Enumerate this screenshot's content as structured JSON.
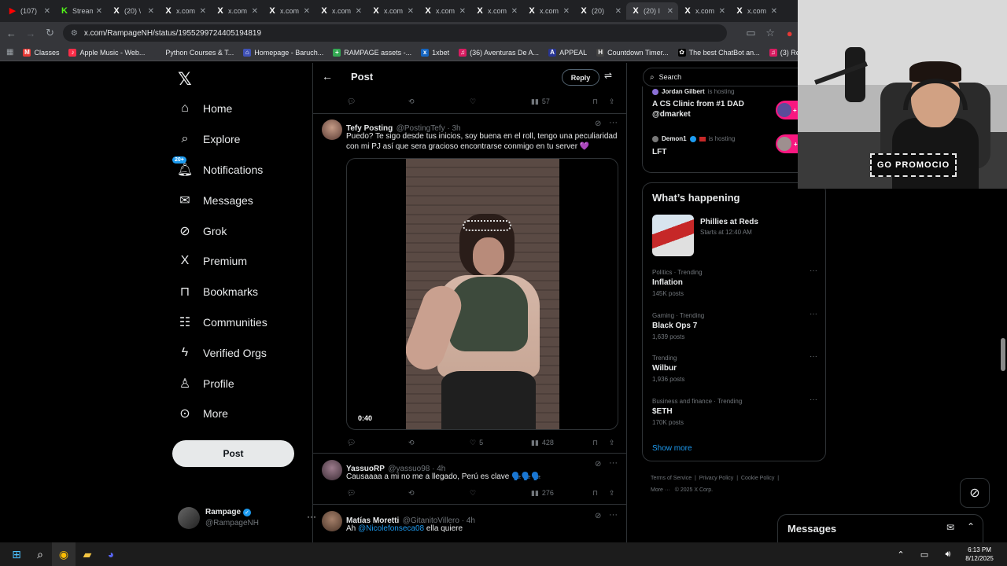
{
  "browser": {
    "tabs": [
      {
        "label": "(107)",
        "icon": "youtube-icon",
        "color": "#ff0000"
      },
      {
        "label": "Stream",
        "icon": "kick-icon",
        "color": "#53fc18"
      },
      {
        "label": "(20) \\",
        "icon": "x-logo-icon",
        "color": "#ffffff"
      },
      {
        "label": "x.com",
        "icon": "x-logo-icon",
        "color": "#ffffff"
      },
      {
        "label": "x.com",
        "icon": "x-logo-icon",
        "color": "#ffffff"
      },
      {
        "label": "x.com",
        "icon": "x-logo-icon",
        "color": "#ffffff"
      },
      {
        "label": "x.com",
        "icon": "x-logo-icon",
        "color": "#ffffff"
      },
      {
        "label": "x.com",
        "icon": "x-logo-icon",
        "color": "#ffffff"
      },
      {
        "label": "x.com",
        "icon": "x-logo-icon",
        "color": "#ffffff"
      },
      {
        "label": "x.com",
        "icon": "x-logo-icon",
        "color": "#ffffff"
      },
      {
        "label": "x.com",
        "icon": "x-logo-icon",
        "color": "#ffffff"
      },
      {
        "label": "(20)",
        "icon": "x-logo-icon",
        "color": "#ffffff"
      },
      {
        "label": "(20) I",
        "icon": "x-logo-icon",
        "color": "#ffffff",
        "active": true
      },
      {
        "label": "x.com",
        "icon": "x-logo-icon",
        "color": "#ffffff"
      },
      {
        "label": "x.com",
        "icon": "x-logo-icon",
        "color": "#ffffff"
      }
    ],
    "url": "x.com/RampageNH/status/1955299724405194819",
    "bookmarks": [
      {
        "label": "Classes",
        "color": "#e53935",
        "glyph": "M"
      },
      {
        "label": "Apple Music - Web...",
        "color": "#fa2d48",
        "glyph": "♪"
      },
      {
        "label": "Python Courses & T...",
        "color": "#35363a",
        "glyph": ""
      },
      {
        "label": "Homepage - Baruch...",
        "color": "#3f51b5",
        "glyph": "⌂"
      },
      {
        "label": "RAMPAGE assets -...",
        "color": "#34a853",
        "glyph": "+"
      },
      {
        "label": "1xbet",
        "color": "#1565c0",
        "glyph": "x"
      },
      {
        "label": "(36) Aventuras De A...",
        "color": "#d81b60",
        "glyph": "♫"
      },
      {
        "label": "APPEAL",
        "color": "#283593",
        "glyph": "A"
      },
      {
        "label": "Countdown Timer...",
        "color": "#424242",
        "glyph": "H"
      },
      {
        "label": "The best ChatBot an...",
        "color": "#000000",
        "glyph": "✿"
      },
      {
        "label": "(3) Reggaeton Nuev...",
        "color": "#d81b60",
        "glyph": "♫"
      }
    ]
  },
  "nav": {
    "items": [
      {
        "label": "Home",
        "icon": "home-icon"
      },
      {
        "label": "Explore",
        "icon": "search-icon"
      },
      {
        "label": "Notifications",
        "icon": "bell-icon",
        "badge": "20+"
      },
      {
        "label": "Messages",
        "icon": "mail-icon"
      },
      {
        "label": "Grok",
        "icon": "grok-icon"
      },
      {
        "label": "Premium",
        "icon": "x-logo-icon"
      },
      {
        "label": "Bookmarks",
        "icon": "bookmark-icon"
      },
      {
        "label": "Communities",
        "icon": "people-icon"
      },
      {
        "label": "Verified Orgs",
        "icon": "lightning-icon"
      },
      {
        "label": "Profile",
        "icon": "person-icon"
      },
      {
        "label": "More",
        "icon": "more-circle-icon"
      }
    ],
    "post_label": "Post",
    "account": {
      "name": "Rampage",
      "handle": "@RampageNH"
    }
  },
  "header": {
    "title": "Post",
    "reply_label": "Reply"
  },
  "top_actions": {
    "views": "57"
  },
  "tweets": [
    {
      "name": "Tefy Posting",
      "handle": "@PostingTefy · 3h",
      "text": "Puedo? Te sigo desde tus inicios, soy buena en el roll, tengo una peculiaridad con mi PJ así que sera gracioso encontrarse conmigo en tu server 💜",
      "video_time": "0:40",
      "likes": "5",
      "views": "428"
    },
    {
      "name": "YassuoRP",
      "handle": "@yassuo98 · 4h",
      "text": "Causaaaa a mi no me a llegado, Perú es clave 🗣️🗣️🗣️",
      "views": "276"
    },
    {
      "name": "Matías Moretti",
      "handle": "@GitanitoVillero · 4h",
      "text_pre": "Ah ",
      "mention": "@Nicolefonseca08",
      "text_post": " ella quiere"
    }
  ],
  "right": {
    "search_placeholder": "Search",
    "spaces": [
      {
        "host": "Jordan Gilbert",
        "status": "is hosting",
        "title": "A CS Clinic from #1 DAD @dmarket",
        "count": "+"
      },
      {
        "host": "Demon1",
        "status": "is hosting",
        "title": "LFT",
        "count": "+1.1K"
      }
    ],
    "happening_title": "What’s happening",
    "event": {
      "title": "Phillies at Reds",
      "time": "Starts at 12:40 AM"
    },
    "trends": [
      {
        "meta": "Politics · Trending",
        "title": "Inflation",
        "count": "145K posts"
      },
      {
        "meta": "Gaming · Trending",
        "title": "Black Ops 7",
        "count": "1,639 posts"
      },
      {
        "meta": "Trending",
        "title": "Wilbur",
        "count": "1,936 posts"
      },
      {
        "meta": "Business and finance · Trending",
        "title": "$ETH",
        "count": "170K posts"
      }
    ],
    "show_more": "Show more",
    "footer": [
      "Terms of Service",
      "Privacy Policy",
      "Cookie Policy",
      "More ···",
      "© 2025 X Corp."
    ],
    "messages_label": "Messages"
  },
  "stream_overlay": {
    "banner": "GO PROMOCIO"
  },
  "taskbar": {
    "time": "6:13 PM",
    "date": "8/12/2025"
  },
  "colors": {
    "accent": "#1d9bf0",
    "background": "#000000",
    "border": "#2f3336",
    "muted": "#71767b"
  }
}
